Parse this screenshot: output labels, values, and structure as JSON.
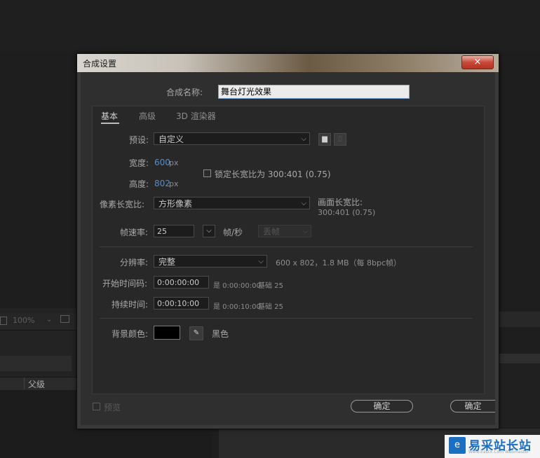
{
  "background": {
    "zoom": "100%",
    "timeline_column": "父级"
  },
  "dialog": {
    "title": "合成设置",
    "close_icon": "×",
    "name_label": "合成名称:",
    "name_value": "舞台灯光效果",
    "tabs": [
      "基本",
      "高级",
      "3D 渲染器"
    ],
    "preset_label": "预设:",
    "preset_value": "自定义",
    "width_label": "宽度:",
    "width_value": "600",
    "width_unit": "px",
    "height_label": "高度:",
    "height_value": "802",
    "height_unit": "px",
    "lock_ratio_label": "锁定长宽比为 300:401 (0.75)",
    "pixel_aspect_label": "像素长宽比:",
    "pixel_aspect_value": "方形像素",
    "frame_aspect_label": "画面长宽比:",
    "frame_aspect_value": "300:401 (0.75)",
    "frame_rate_label": "帧速率:",
    "frame_rate_value": "25",
    "frame_rate_unit": "帧/秒",
    "drop_frame_value": "丢帧",
    "resolution_label": "分辨率:",
    "resolution_value": "完整",
    "resolution_info": "600 x 802，1.8 MB（每 8bpc帧）",
    "start_tc_label": "开始时间码:",
    "start_tc_value": "0:00:00:00",
    "start_tc_info": "是 0:00:00:00",
    "start_tc_base": "基础 25",
    "duration_label": "持续时间:",
    "duration_value": "0:00:10:00",
    "duration_info": "是 0:00:10:00",
    "duration_base": "基础 25",
    "bg_color_label": "背景颜色:",
    "bg_color_name": "黑色",
    "bg_color_hex": "#000000",
    "preview_label": "预览",
    "ok_label": "确定",
    "ok_label_2": "确定"
  },
  "watermark": {
    "logo": "e",
    "text": "易采站长站",
    "sub": "Www.Easck.Com Webmaster"
  }
}
